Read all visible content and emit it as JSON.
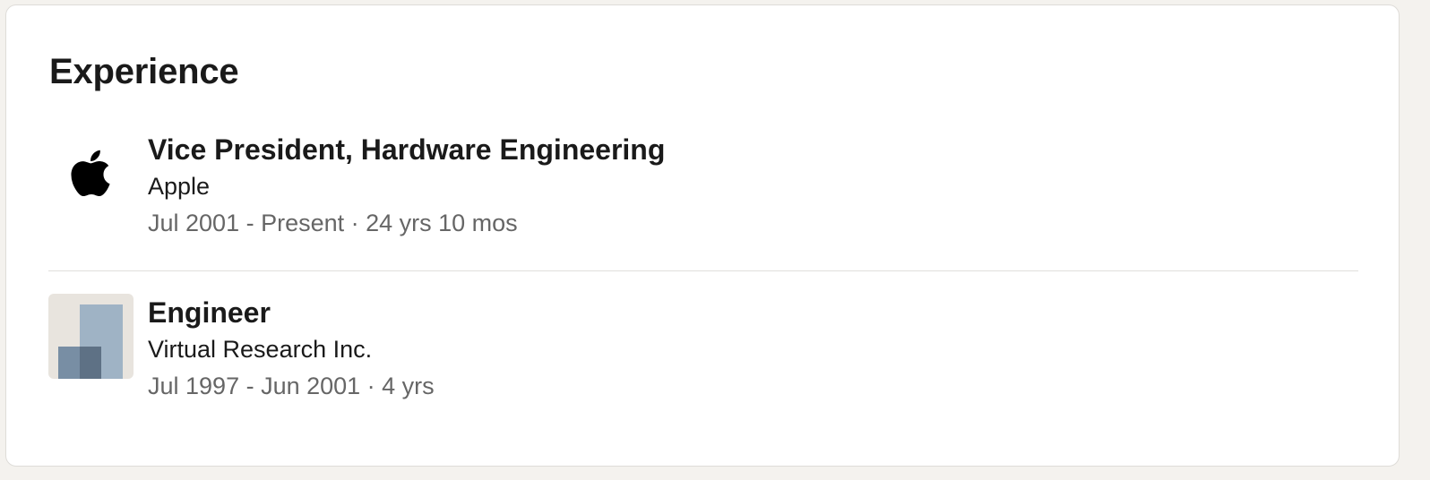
{
  "section": {
    "title": "Experience"
  },
  "experience": [
    {
      "title": "Vice President, Hardware Engineering",
      "company": "Apple",
      "dates": "Jul 2001 - Present · 24 yrs 10 mos",
      "logo_icon": "apple-logo-icon"
    },
    {
      "title": "Engineer",
      "company": "Virtual Research Inc.",
      "dates": "Jul 1997 - Jun 2001 · 4 yrs",
      "logo_icon": "company-placeholder-logo-icon"
    }
  ],
  "colors": {
    "page_background": "#f4f2ee",
    "card_background": "#ffffff",
    "primary_text": "#1a1a1a",
    "secondary_text": "#666666",
    "placeholder_logo_bg": "#e8e4de",
    "placeholder_logo_light": "#9fb3c5",
    "placeholder_logo_dark": "#788ea4"
  }
}
